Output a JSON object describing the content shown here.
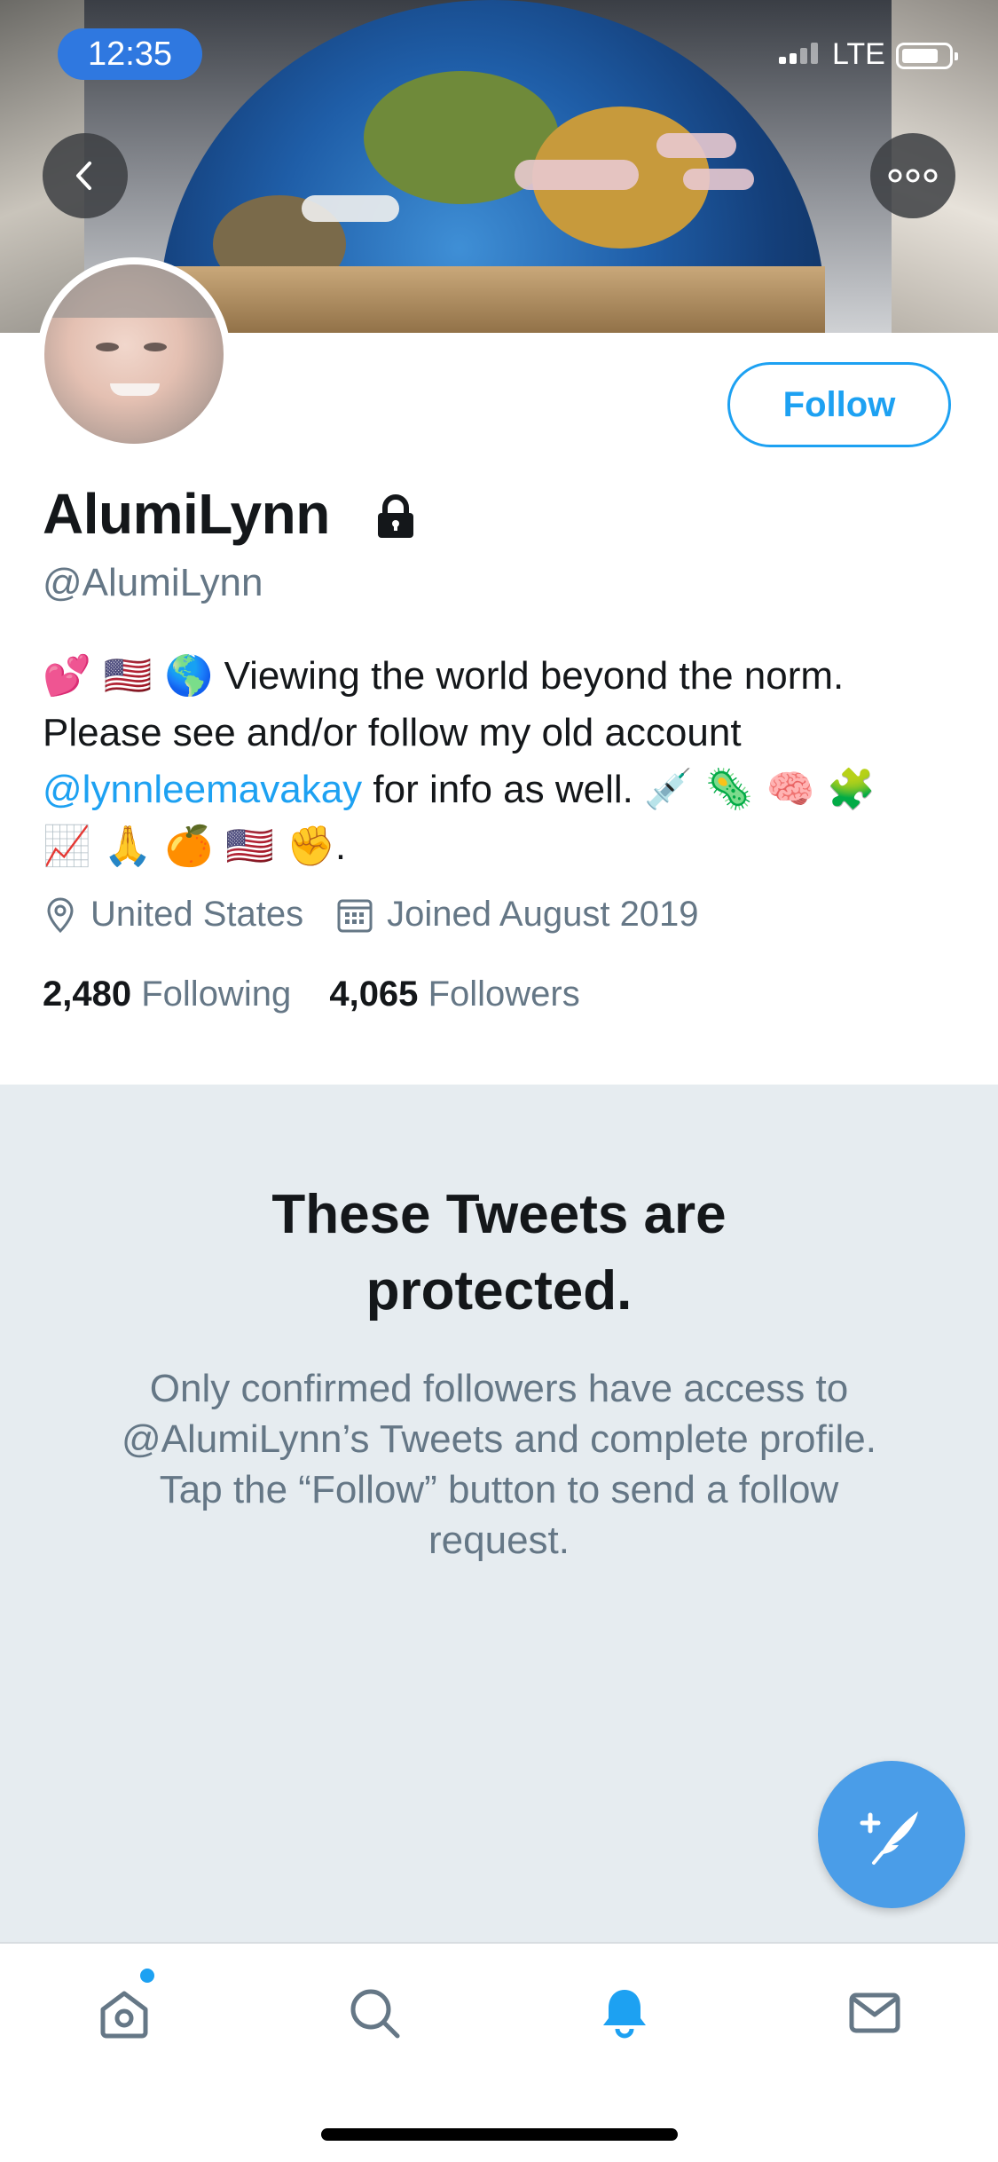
{
  "status_bar": {
    "time": "12:35",
    "network": "LTE"
  },
  "profile": {
    "display_name": "AlumiLynn",
    "handle": "@AlumiLynn",
    "follow_label": "Follow",
    "bio": {
      "line1_emoji": "💕 🇺🇸 🌎",
      "line1_text": "Viewing the world beyond the norm.",
      "line2_text": "Please see and/or follow my old account",
      "mention": "@lynnleemavakay",
      "line3_text": " for info as well.",
      "line3_emoji": "💉 🦠 🧠 🧩",
      "line4_emoji": "📈 🙏 🍊 🇺🇸 ✊",
      "line4_end": "."
    },
    "location": "United States",
    "joined": "Joined August 2019",
    "following_count": "2,480",
    "following_label": "Following",
    "followers_count": "4,065",
    "followers_label": "Followers"
  },
  "protected_notice": {
    "title_line1": "These Tweets are",
    "title_line2": "protected.",
    "body": "Only confirmed followers have access to @AlumiLynn’s Tweets and complete profile. Tap the “Follow” button to send a follow request."
  },
  "colors": {
    "accent": "#1da1f2",
    "secondary_text": "#657786",
    "protected_bg": "#e6ecf0",
    "fab": "#4a9de8"
  },
  "icons": {
    "back": "chevron-left-icon",
    "more": "more-dots-icon",
    "lock": "lock-icon",
    "location": "location-pin-icon",
    "calendar": "calendar-icon",
    "compose": "compose-tweet-icon",
    "tabs": [
      "home-icon",
      "search-icon",
      "notifications-bell-icon",
      "messages-envelope-icon"
    ]
  }
}
